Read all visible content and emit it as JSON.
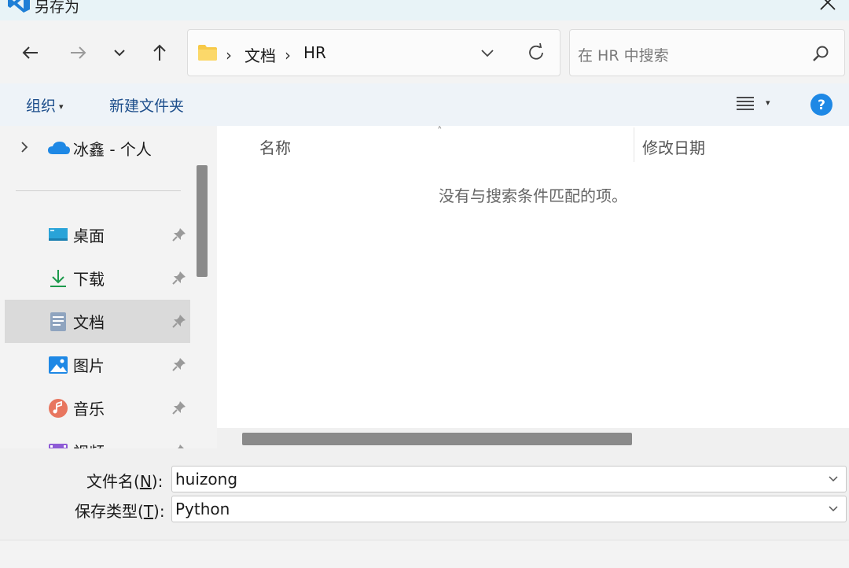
{
  "window": {
    "title": "另存为"
  },
  "address": {
    "crumbs": [
      "文档",
      "HR"
    ]
  },
  "search": {
    "placeholder": "在 HR 中搜索"
  },
  "commands": {
    "organize": "组织",
    "new_folder": "新建文件夹"
  },
  "sidebar": {
    "cloud_label": "冰鑫 - 个人",
    "items": [
      {
        "label": "桌面",
        "icon": "desktop-icon",
        "selected": false
      },
      {
        "label": "下载",
        "icon": "download-icon",
        "selected": false
      },
      {
        "label": "文档",
        "icon": "documents-icon",
        "selected": true
      },
      {
        "label": "图片",
        "icon": "pictures-icon",
        "selected": false
      },
      {
        "label": "音乐",
        "icon": "music-icon",
        "selected": false
      },
      {
        "label": "视频",
        "icon": "videos-icon",
        "selected": false
      }
    ]
  },
  "columns": {
    "name": "名称",
    "date": "修改日期"
  },
  "content": {
    "empty_message": "没有与搜索条件匹配的项。"
  },
  "form": {
    "filename_label": "文件名(",
    "filename_key": "N",
    "filename_suffix": "):",
    "filename_value": "huizong",
    "type_label": "保存类型(",
    "type_key": "T",
    "type_suffix": "):",
    "type_value": "Python"
  },
  "colors": {
    "accent": "#1e4f8c",
    "help": "#1e88e5",
    "folder": "#f7c948"
  }
}
